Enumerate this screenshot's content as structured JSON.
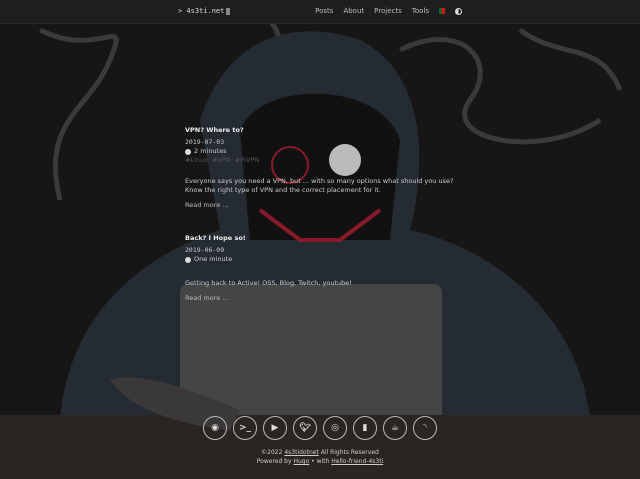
{
  "header": {
    "logo": "> 4s3ti.net",
    "nav": [
      "Posts",
      "About",
      "Projects",
      "Tools"
    ],
    "flag_icon": "portugal-flag-icon",
    "theme_icon": "theme-toggle-icon"
  },
  "posts": [
    {
      "title": "VPN? Where to?",
      "date": "2019-07-03",
      "reading_time": "2 minutes",
      "tags": [
        "#Linux",
        "#VPN",
        "#PIVPN"
      ],
      "summary": "Everyone says you need a VPN, but ... with so many options what should you use? Know the right type of VPN and the correct placement for it.",
      "read_more": "Read more ..."
    },
    {
      "title": "Back? I Hope so!",
      "date": "2019-06-09",
      "reading_time": "One minute",
      "tags": [],
      "summary": "Getting back to Active! OSS, Blog, Twitch, youtube!",
      "read_more": "Read more ..."
    }
  ],
  "footer": {
    "socials": [
      "github",
      "terminal",
      "youtube",
      "twitter",
      "instagram",
      "twitch",
      "ko-fi",
      "rss"
    ],
    "copyright_prefix": "©2022 ",
    "copyright_link": "4s3tidotnet",
    "copyright_suffix": " All Rights Reserved",
    "powered_prefix": "Powered by ",
    "hugo": "Hugo",
    "powered_mid": " • with ",
    "theme": "Hello-friend-4s3ti"
  }
}
